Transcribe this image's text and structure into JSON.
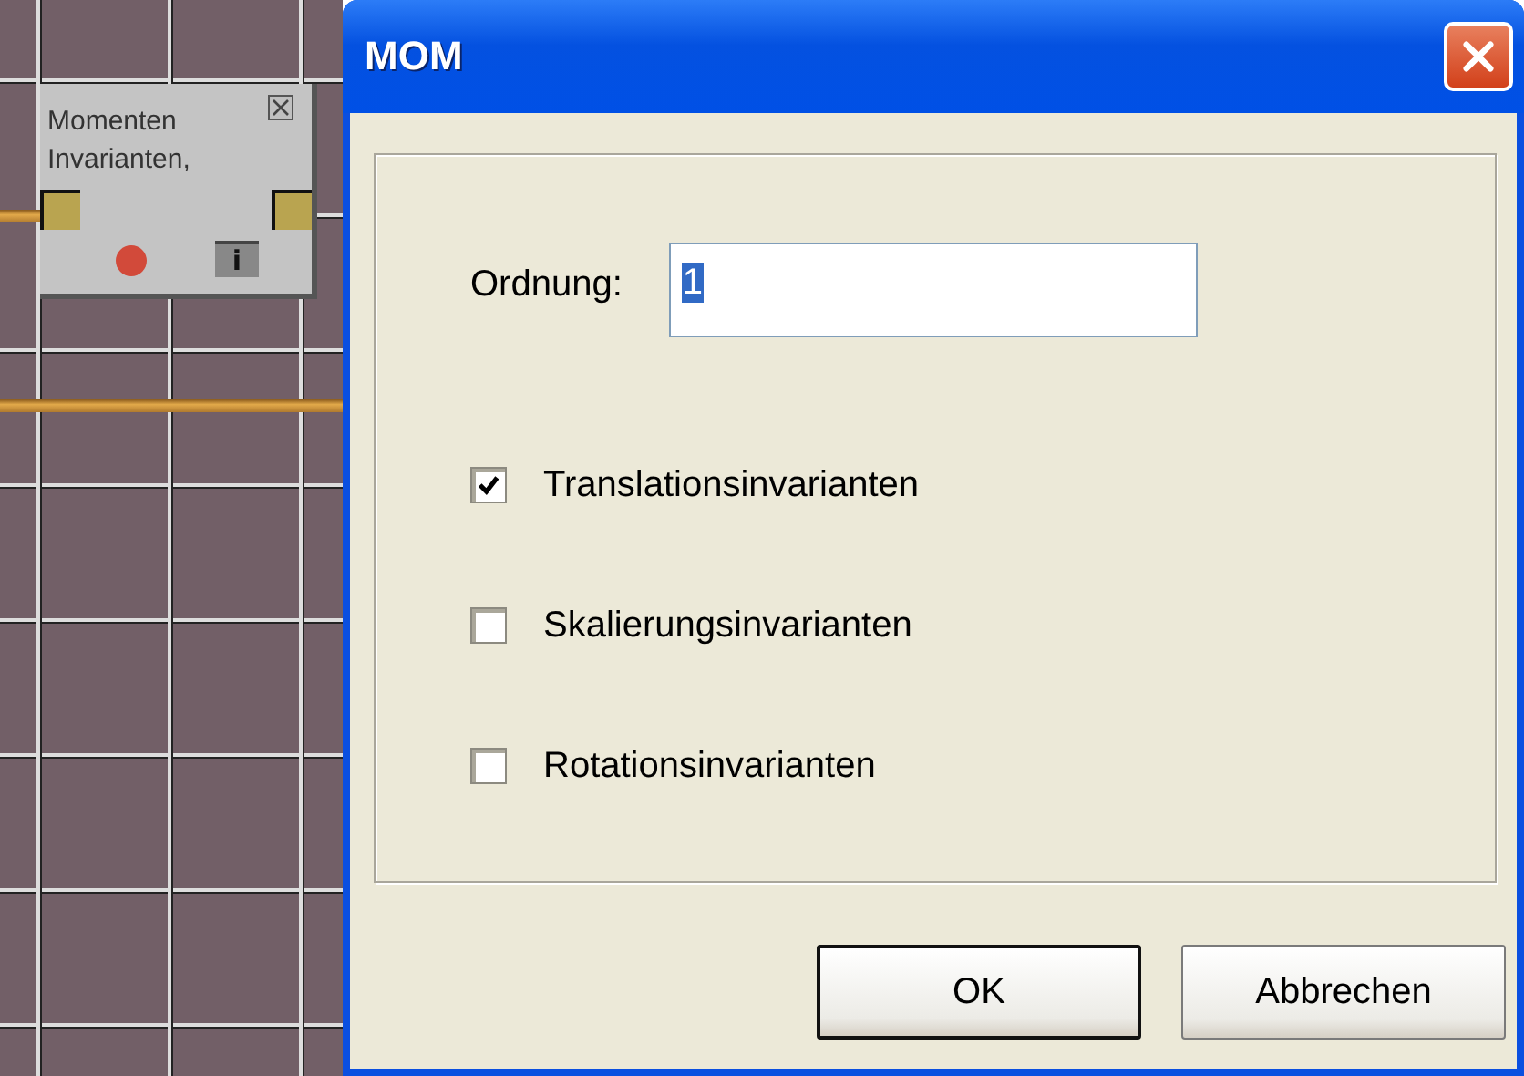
{
  "canvas": {
    "node": {
      "title": "Momenten Invarianten,",
      "info_label": "i"
    }
  },
  "window": {
    "title": "MOM"
  },
  "form": {
    "order_label": "Ordnung:",
    "order_value": "1",
    "options": [
      {
        "label": "Translationsinvarianten",
        "checked": true
      },
      {
        "label": "Skalierungsinvarianten",
        "checked": false
      },
      {
        "label": "Rotationsinvarianten",
        "checked": false
      }
    ]
  },
  "buttons": [
    {
      "label": "OK",
      "default": true
    },
    {
      "label": "Abbrechen",
      "default": false
    }
  ]
}
